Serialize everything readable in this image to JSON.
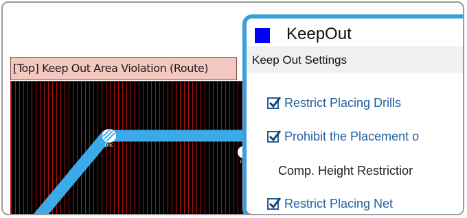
{
  "pcb_view": {
    "violation_label": "[Top] Keep Out Area Violation (Route)",
    "drc_marker_1": "DRC",
    "drc_marker_2": "D",
    "colors": {
      "board_background": "#000000",
      "grid_lines": "#b01010",
      "trace": "#3aaae8",
      "label_background": "#f2c8c0"
    }
  },
  "dialog": {
    "title": "KeepOut",
    "swatch_color": "#0000ff",
    "section_header": "Keep Out Settings",
    "settings": [
      {
        "label": "Restrict Placing Drills",
        "checked": true
      },
      {
        "label": "Prohibit the Placement o",
        "checked": true
      },
      {
        "label": "Comp. Height Restrictior",
        "checked": null
      },
      {
        "label": "Restrict Placing Net",
        "checked": true
      }
    ],
    "highlight_border_color": "#3aa0da"
  }
}
